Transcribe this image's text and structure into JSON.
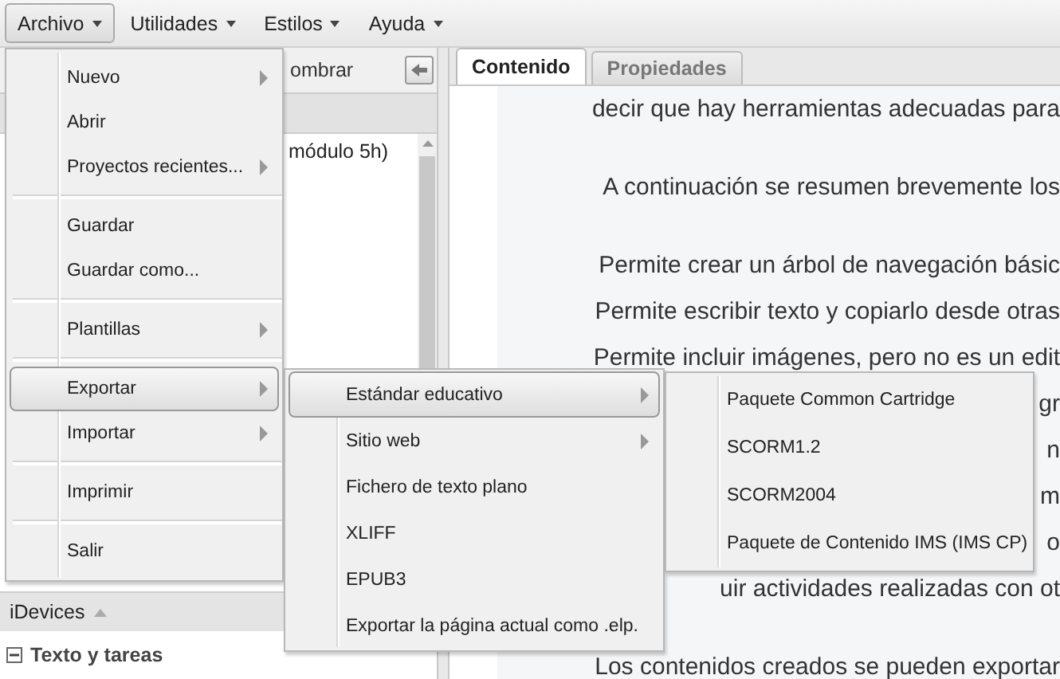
{
  "menubar": [
    {
      "label": "Archivo",
      "selected": true
    },
    {
      "label": "Utilidades",
      "selected": false
    },
    {
      "label": "Estilos",
      "selected": false
    },
    {
      "label": "Ayuda",
      "selected": false
    }
  ],
  "left_panel": {
    "toolbar_button": "ombrar",
    "tree_item": "módulo 5h)",
    "idevices_header": "iDevices",
    "idevices_category": "Texto y tareas"
  },
  "tabs": [
    {
      "label": "Contenido",
      "selected": true
    },
    {
      "label": "Propiedades",
      "selected": false
    }
  ],
  "content_lines": [
    {
      "text": "decir que hay herramientas adecuadas para",
      "kind": "cut",
      "new_paragraph": false
    },
    {
      "text": "A continuación se resumen brevemente los",
      "kind": "cut",
      "new_paragraph": true
    },
    {
      "text": "Permite crear un árbol de navegación básic",
      "kind": "cut",
      "new_paragraph": true
    },
    {
      "text": "Permite escribir texto y copiarlo desde otras",
      "kind": "cut",
      "new_paragraph": false
    },
    {
      "text": "Permite incluir imágenes, pero no es un edit",
      "kind": "cut",
      "new_paragraph": false
    },
    {
      "text": "gr",
      "kind": "cut",
      "new_paragraph": false
    },
    {
      "text": "n",
      "kind": "cut",
      "new_paragraph": false
    },
    {
      "text": "m",
      "kind": "cut",
      "new_paragraph": false
    },
    {
      "text": "o",
      "kind": "cut",
      "new_paragraph": false
    },
    {
      "text": "uir actividades realizadas con ot",
      "kind": "cut",
      "new_paragraph": false
    },
    {
      "text": "Los contenidos creados se pueden exportar",
      "kind": "cut",
      "new_paragraph": true
    }
  ],
  "menus": [
    {
      "items": [
        {
          "kind": "item",
          "label": "Nuevo",
          "submenu": true,
          "selected": false
        },
        {
          "kind": "item",
          "label": "Abrir",
          "submenu": false,
          "selected": false
        },
        {
          "kind": "item",
          "label": "Proyectos recientes...",
          "submenu": true,
          "selected": false
        },
        {
          "kind": "separator"
        },
        {
          "kind": "item",
          "label": "Guardar",
          "submenu": false,
          "selected": false
        },
        {
          "kind": "item",
          "label": "Guardar como...",
          "submenu": false,
          "selected": false
        },
        {
          "kind": "separator"
        },
        {
          "kind": "item",
          "label": "Plantillas",
          "submenu": true,
          "selected": false
        },
        {
          "kind": "separator"
        },
        {
          "kind": "item",
          "label": "Exportar",
          "submenu": true,
          "selected": true
        },
        {
          "kind": "item",
          "label": "Importar",
          "submenu": true,
          "selected": false
        },
        {
          "kind": "separator"
        },
        {
          "kind": "item",
          "label": "Imprimir",
          "submenu": false,
          "selected": false
        },
        {
          "kind": "separator"
        },
        {
          "kind": "item",
          "label": "Salir",
          "submenu": false,
          "selected": false
        }
      ]
    },
    {
      "items": [
        {
          "kind": "item",
          "label": "Estándar educativo",
          "submenu": true,
          "selected": true
        },
        {
          "kind": "item",
          "label": "Sitio web",
          "submenu": true,
          "selected": false
        },
        {
          "kind": "item",
          "label": "Fichero de texto plano",
          "submenu": false,
          "selected": false
        },
        {
          "kind": "item",
          "label": "XLIFF",
          "submenu": false,
          "selected": false
        },
        {
          "kind": "item",
          "label": "EPUB3",
          "submenu": false,
          "selected": false
        },
        {
          "kind": "item",
          "label": "Exportar la página actual como .elp.",
          "submenu": false,
          "selected": false
        }
      ]
    },
    {
      "items": [
        {
          "kind": "item",
          "label": "Paquete Common Cartridge",
          "submenu": false,
          "selected": false
        },
        {
          "kind": "item",
          "label": "SCORM1.2",
          "submenu": false,
          "selected": false
        },
        {
          "kind": "item",
          "label": "SCORM2004",
          "submenu": false,
          "selected": false
        },
        {
          "kind": "item",
          "label": "Paquete de Contenido IMS (IMS CP)",
          "submenu": false,
          "selected": false
        }
      ]
    }
  ]
}
